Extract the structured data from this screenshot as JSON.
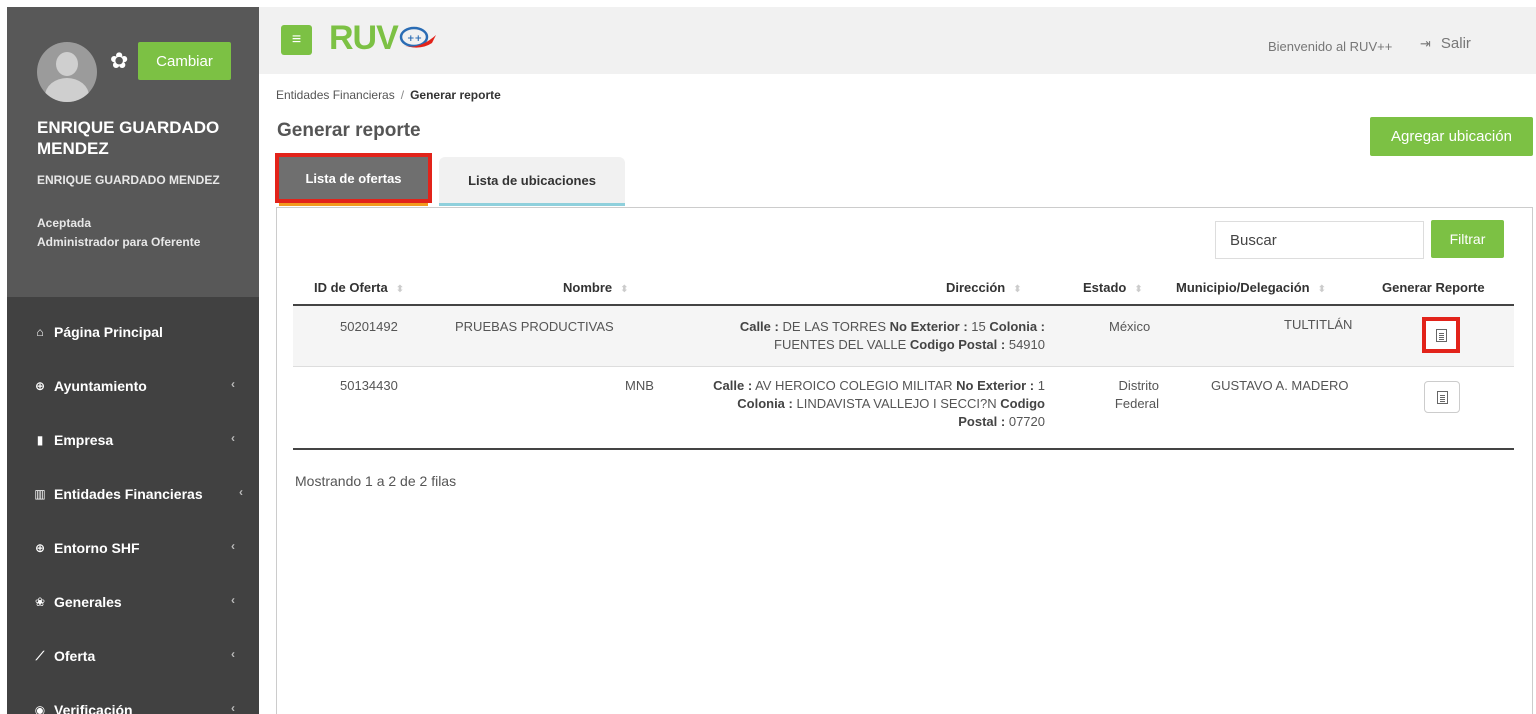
{
  "user": {
    "change_label": "Cambiar",
    "name": "ENRIQUE GUARDADO MENDEZ",
    "subname": "ENRIQUE GUARDADO MENDEZ",
    "status": "Aceptada",
    "role": "Administrador para Oferente"
  },
  "nav": {
    "items": [
      {
        "label": "Página Principal",
        "icon": "home-icon",
        "glyph": "⌂"
      },
      {
        "label": "Ayuntamiento",
        "icon": "plus-circle-icon",
        "glyph": "⊕"
      },
      {
        "label": "Empresa",
        "icon": "building-icon",
        "glyph": "▮"
      },
      {
        "label": "Entidades Financieras",
        "icon": "bank-icon",
        "glyph": "▥"
      },
      {
        "label": "Entorno SHF",
        "icon": "plus-circle-icon",
        "glyph": "⊕"
      },
      {
        "label": "Generales",
        "icon": "group-icon",
        "glyph": "❀"
      },
      {
        "label": "Oferta",
        "icon": "line-chart-icon",
        "glyph": "⟋"
      },
      {
        "label": "Verificación",
        "icon": "dot-circle-icon",
        "glyph": "◉"
      }
    ]
  },
  "topbar": {
    "logo": "RUV",
    "welcome": "Bienvenido al RUV++",
    "logout": "Salir"
  },
  "breadcrumb": {
    "parent": "Entidades Financieras",
    "separator": "/",
    "current": "Generar reporte"
  },
  "page": {
    "title": "Generar reporte",
    "add_location": "Agregar ubicación"
  },
  "tabs": {
    "ofertas": "Lista de ofertas",
    "ubicaciones": "Lista de ubicaciones"
  },
  "search": {
    "placeholder": "Buscar",
    "filter_label": "Filtrar"
  },
  "table": {
    "headers": [
      "ID de Oferta",
      "Nombre",
      "Dirección",
      "Estado",
      "Municipio/Delegación",
      "Generar Reporte"
    ],
    "rows": [
      {
        "id": "50201492",
        "nombre": "PRUEBAS PRODUCTIVAS",
        "calle_label": "Calle :",
        "calle": "DE LAS TORRES",
        "noext_label": "No Exterior :",
        "noext": "15",
        "colonia_label": "Colonia :",
        "colonia": "FUENTES DEL VALLE",
        "cp_label": "Codigo Postal :",
        "cp": "54910",
        "estado": "México",
        "municipio": "TULTITLÁN"
      },
      {
        "id": "50134430",
        "nombre": "MNB",
        "calle_label": "Calle :",
        "calle": "AV HEROICO COLEGIO MILITAR",
        "noext_label": "No Exterior :",
        "noext": "1",
        "colonia_label": "Colonia :",
        "colonia": "LINDAVISTA VALLEJO I SECCI?N",
        "cp_label_a": "Codigo",
        "cp_label_b": "Postal :",
        "cp": "07720",
        "estado_a": "Distrito",
        "estado_b": "Federal",
        "municipio": "GUSTAVO A. MADERO"
      }
    ],
    "footer": "Mostrando 1 a 2 de 2 filas"
  },
  "colors": {
    "accent_green": "#7cc144",
    "sidebar_dark": "#414141",
    "highlight_red": "#e2231a"
  }
}
